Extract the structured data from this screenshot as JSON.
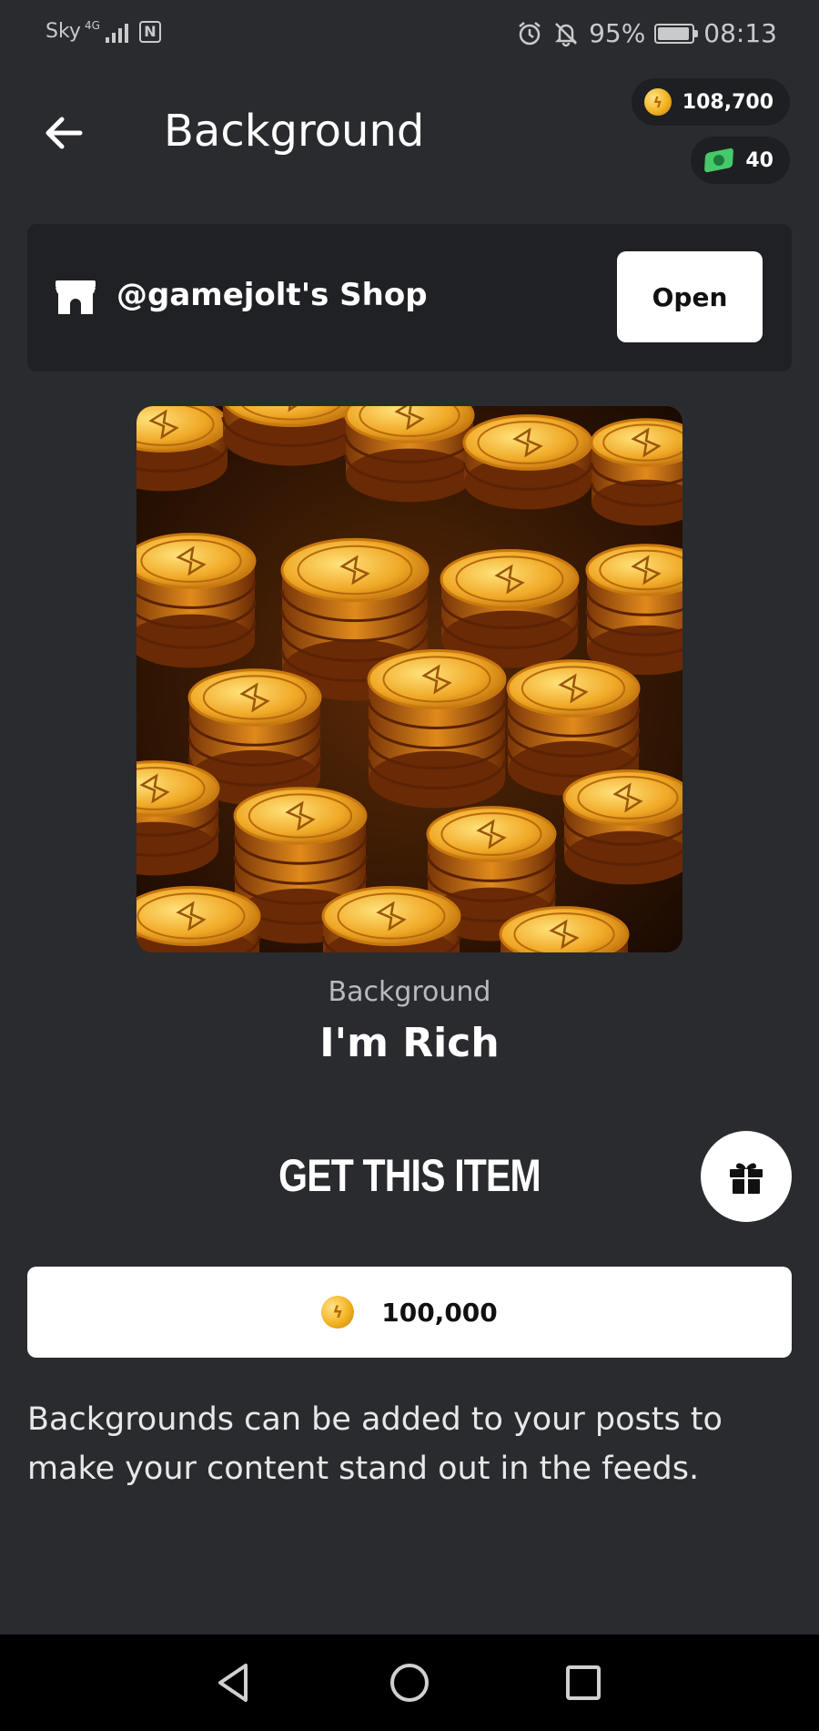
{
  "status_bar": {
    "carrier": "Sky",
    "network": "4G",
    "nfc_label": "N",
    "battery_percent": "95%",
    "battery_level": 0.95,
    "time": "08:13",
    "icons": [
      "alarm-icon",
      "bell-off-icon",
      "battery-icon"
    ]
  },
  "header": {
    "title": "Background",
    "back_icon": "arrow-left-icon",
    "coins_balance": "108,700",
    "gems_balance": "40"
  },
  "shop": {
    "icon": "storefront-icon",
    "name": "@gamejolt's Shop",
    "open_label": "Open"
  },
  "item": {
    "image_description_icon": "gold-coins-artwork",
    "category": "Background",
    "name": "I'm Rich"
  },
  "purchase": {
    "heading": "GET THIS ITEM",
    "gift_icon": "gift-icon",
    "price": "100,000",
    "currency_icon": "coin-icon"
  },
  "description": "Backgrounds can be added to your posts to make your content stand out in the feeds.",
  "navigation": {
    "icons": [
      "nav-back-icon",
      "nav-home-icon",
      "nav-recents-icon"
    ]
  },
  "colors": {
    "background": "#292b2f",
    "card": "#1f2124",
    "pill": "#1d1f22",
    "coin": "#f2b322",
    "gem": "#46c96a"
  }
}
